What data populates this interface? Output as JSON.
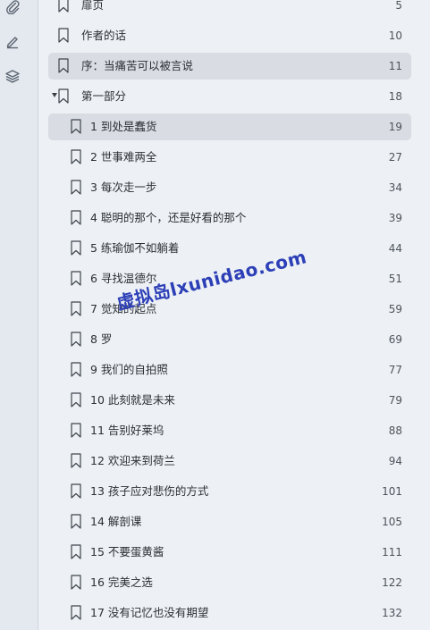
{
  "rail": {
    "icons": [
      "paperclip-icon",
      "pen-icon",
      "layers-icon"
    ]
  },
  "toc": {
    "items": [
      {
        "label": "扉页",
        "page": "5"
      },
      {
        "label": "作者的话",
        "page": "10"
      },
      {
        "label": "序：当痛苦可以被言说",
        "page": "11"
      },
      {
        "label": "第一部分",
        "page": "18"
      },
      {
        "label": "1 到处是蠢货",
        "page": "19"
      },
      {
        "label": "2 世事难两全",
        "page": "27"
      },
      {
        "label": "3 每次走一步",
        "page": "34"
      },
      {
        "label": "4 聪明的那个，还是好看的那个",
        "page": "39"
      },
      {
        "label": "5 练瑜伽不如躺着",
        "page": "44"
      },
      {
        "label": "6 寻找温德尔",
        "page": "51"
      },
      {
        "label": "7 觉知的起点",
        "page": "59"
      },
      {
        "label": "8 罗",
        "page": "69"
      },
      {
        "label": "9 我们的自拍照",
        "page": "77"
      },
      {
        "label": "10 此刻就是未来",
        "page": "79"
      },
      {
        "label": "11 告别好莱坞",
        "page": "88"
      },
      {
        "label": "12 欢迎来到荷兰",
        "page": "94"
      },
      {
        "label": "13 孩子应对悲伤的方式",
        "page": "101"
      },
      {
        "label": "14 解剖课",
        "page": "105"
      },
      {
        "label": "15 不要蛋黄酱",
        "page": "111"
      },
      {
        "label": "16 完美之选",
        "page": "122"
      },
      {
        "label": "17 没有记忆也没有期望",
        "page": "132"
      }
    ]
  },
  "watermark": "虚拟岛lxunidao.com",
  "colors": {
    "background": "#edf1f5",
    "selected": "#d9dde3",
    "watermark": "#2d3fb7"
  }
}
